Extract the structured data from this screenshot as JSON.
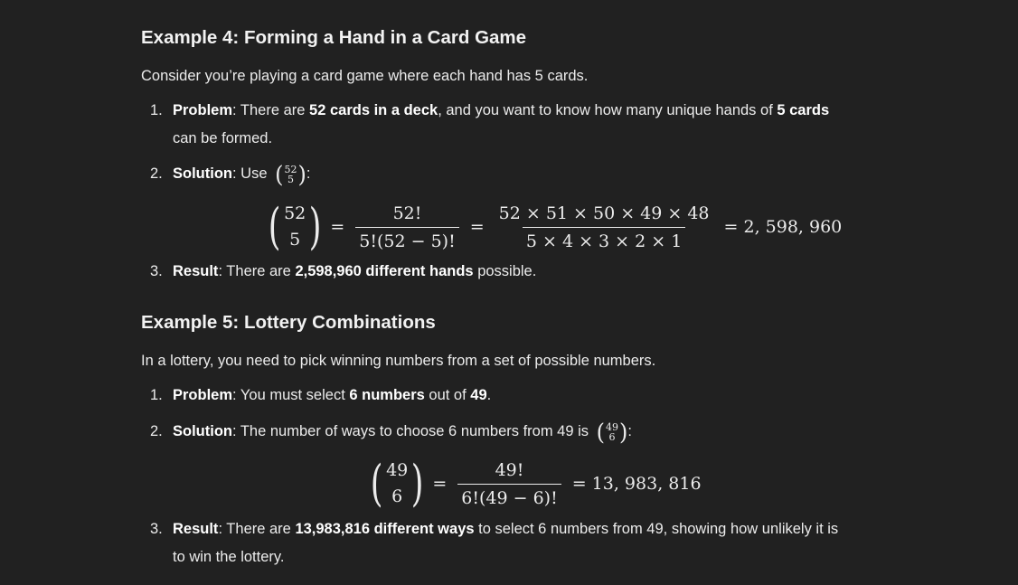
{
  "ex4": {
    "heading": "Example 4: Forming a Hand in a Card Game",
    "lead": "Consider you’re playing a card game where each hand has 5 cards.",
    "item1": {
      "num": "1.",
      "label": "Problem",
      "t1": ": There are ",
      "b1": "52 cards in a deck",
      "t2": ", and you want to know how many unique hands of ",
      "b2": "5 cards",
      "t3": " can be formed."
    },
    "item2": {
      "num": "2.",
      "label": "Solution",
      "t1": ": Use ",
      "binom_n": "52",
      "binom_k": "5",
      "t2": ":"
    },
    "formula": {
      "binom_n": "52",
      "binom_k": "5",
      "eq": "=",
      "frac1_num": "52!",
      "frac1_den": "5!(52 − 5)!",
      "frac2_num": "52 × 51 × 50 × 49 × 48",
      "frac2_den": "5 × 4 × 3 × 2 × 1",
      "result": "= 2, 598, 960"
    },
    "item3": {
      "num": "3.",
      "label": "Result",
      "t1": ": There are ",
      "b1": "2,598,960 different hands",
      "t2": " possible."
    }
  },
  "ex5": {
    "heading": "Example 5: Lottery Combinations",
    "lead": "In a lottery, you need to pick winning numbers from a set of possible numbers.",
    "item1": {
      "num": "1.",
      "label": "Problem",
      "t1": ": You must select ",
      "b1": "6 numbers",
      "t2": " out of ",
      "b2": "49",
      "t3": "."
    },
    "item2": {
      "num": "2.",
      "label": "Solution",
      "t1": ": The number of ways to choose 6 numbers from 49 is ",
      "binom_n": "49",
      "binom_k": "6",
      "t2": ":"
    },
    "formula": {
      "binom_n": "49",
      "binom_k": "6",
      "eq": "=",
      "frac1_num": "49!",
      "frac1_den": "6!(49 − 6)!",
      "result": "= 13, 983, 816"
    },
    "item3": {
      "num": "3.",
      "label": "Result",
      "t1": ": There are ",
      "b1": "13,983,816 different ways",
      "t2": " to select 6 numbers from 49, showing how unlikely it is to win the lottery."
    }
  }
}
